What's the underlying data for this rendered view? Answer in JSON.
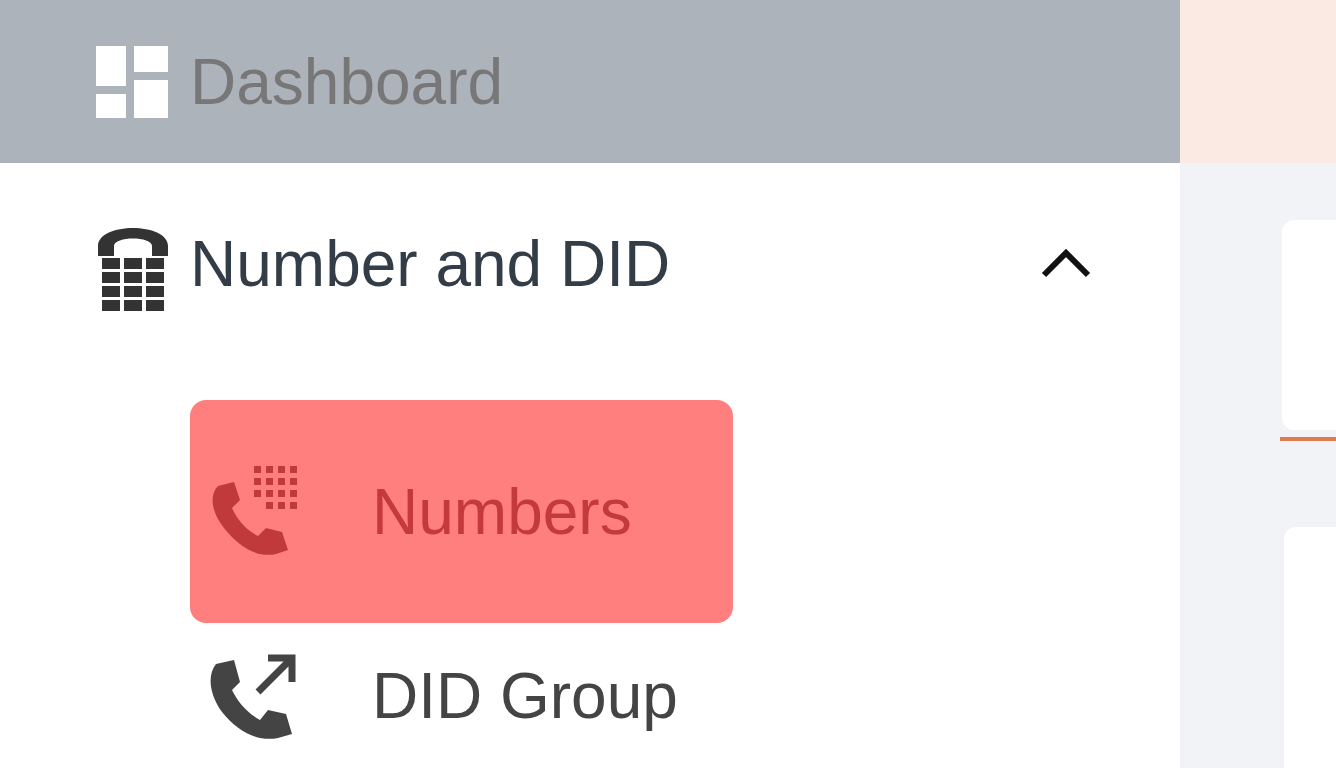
{
  "sidebar": {
    "header": {
      "label": "Dashboard"
    },
    "groups": [
      {
        "label": "Number and DID",
        "expanded": true,
        "children": [
          {
            "label": "Numbers",
            "selected": true,
            "kind": "keypad-phone"
          },
          {
            "label": "DID Group",
            "selected": false,
            "kind": "forward-phone"
          }
        ]
      }
    ]
  }
}
